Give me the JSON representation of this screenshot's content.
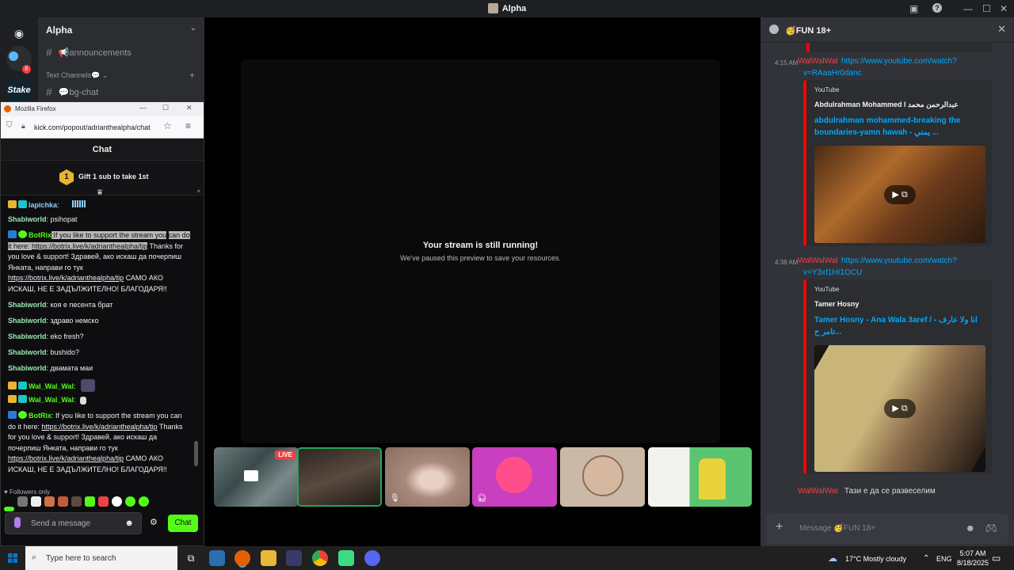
{
  "window": {
    "title": "Alpha"
  },
  "discord": {
    "server_name": "Alpha",
    "rail_badge": "6",
    "rail_stake_label": "Stake",
    "channels": {
      "announcements": "📢announcements",
      "category": "Text Channels💬",
      "bgchat": "💬bg-chat"
    }
  },
  "firefox": {
    "title": "Mozilla Firefox",
    "url": "kick.com/popout/adrianthealpha/chat"
  },
  "kick": {
    "header": "Chat",
    "gift_rank": "1",
    "gift_text": "Gift 1 sub to take 1st",
    "followers_only": "Followers only",
    "input_placeholder": "Send a message",
    "chat_button": "Chat",
    "messages": [
      {
        "user": "lapichka",
        "text": ":"
      },
      {
        "user": "Shabiworld",
        "text": ": psihopat"
      },
      {
        "user": "BotRix",
        "text_hl_a": "If you like to support the stream you",
        "text_hl_b": "can do it here: ",
        "link_hl": "https://botrix.live/k/adrianthealpha/tip",
        "text_a": "Thanks for you love & support! Здравей, ако искаш да почерпиш Янката, направи го тук ",
        "link_b": "https://botrix.live/k/adrianthealpha/tip",
        "text_b": " САМО АКО ИСКАШ, НЕ Е ЗАДЪЛЖИТЕЛНО! БЛАГОДАРЯ!!"
      },
      {
        "user": "Shabiworld",
        "text": ": коя е песента брат"
      },
      {
        "user": "Shabiworld",
        "text": ": здраво немско"
      },
      {
        "user": "Shabiworld",
        "text": ": eko fresh?"
      },
      {
        "user": "Shabiworld",
        "text": ": bushido?"
      },
      {
        "user": "Shabiworld",
        "text": ": двамата маи"
      },
      {
        "user": "Wal_Wal_Wal",
        "text": ":"
      },
      {
        "user": "Wal_Wal_Wal",
        "text": ":"
      },
      {
        "user": "BotRix",
        "text_a": ": If you like to support the stream you can do it here: ",
        "link_a": "https://botrix.live/k/adrianthealpha/tip",
        "text_b": " Thanks for you love & support! Здравей, ако искаш да почерпиш Янката, направи го тук ",
        "link_b": "https://botrix.live/k/adrianthealpha/tip",
        "text_c": " САМО АКО ИСКАШ, НЕ Е ЗАДЪЛЖИТЕЛНО! БЛАГОДАРЯ!!"
      }
    ]
  },
  "stream": {
    "heading": "Your stream is still running!",
    "subtext": "We've paused this preview to save your resources.",
    "live_badge": "LIVE"
  },
  "right_panel": {
    "channel": "🥳FUN 18+",
    "messages": [
      {
        "time": "4:15 AM",
        "author": "WalWalWal",
        "link_1": "https://www.youtube.com/watch?",
        "link_2": "v=RAaaHr0danc",
        "provider": "YouTube",
        "embed_author": "Abdulrahman Mohammed I عبدالرحمن محمد",
        "embed_title": "abdulrahman mohammed-breaking the boundaries-yamn hawah - يمني ..."
      },
      {
        "time": "4:38 AM",
        "author": "WalWalWal",
        "link_1": "https://www.youtube.com/watch?",
        "link_2": "v=Y3xf1HI1OCU",
        "provider": "YouTube",
        "embed_author": "Tamer Hosny",
        "embed_title": "Tamer Hosny - Ana Wala 3aref / انا ولا عارف - تامر ح..."
      }
    ],
    "last_author": "WalWalWal",
    "last_text": "Тази е да се развеселим",
    "input_placeholder": "Message 🥳FUN 18+"
  },
  "taskbar": {
    "search_placeholder": "Type here to search",
    "weather": "17°C  Mostly cloudy",
    "language": "ENG",
    "time": "5:07 AM",
    "date": "8/18/2025"
  },
  "colors": {
    "discord_bg": "#313338",
    "kick_green": "#53fc18",
    "live_red": "#ed4245",
    "link_blue": "#00a8fc",
    "youtube_red": "#ff0000"
  }
}
